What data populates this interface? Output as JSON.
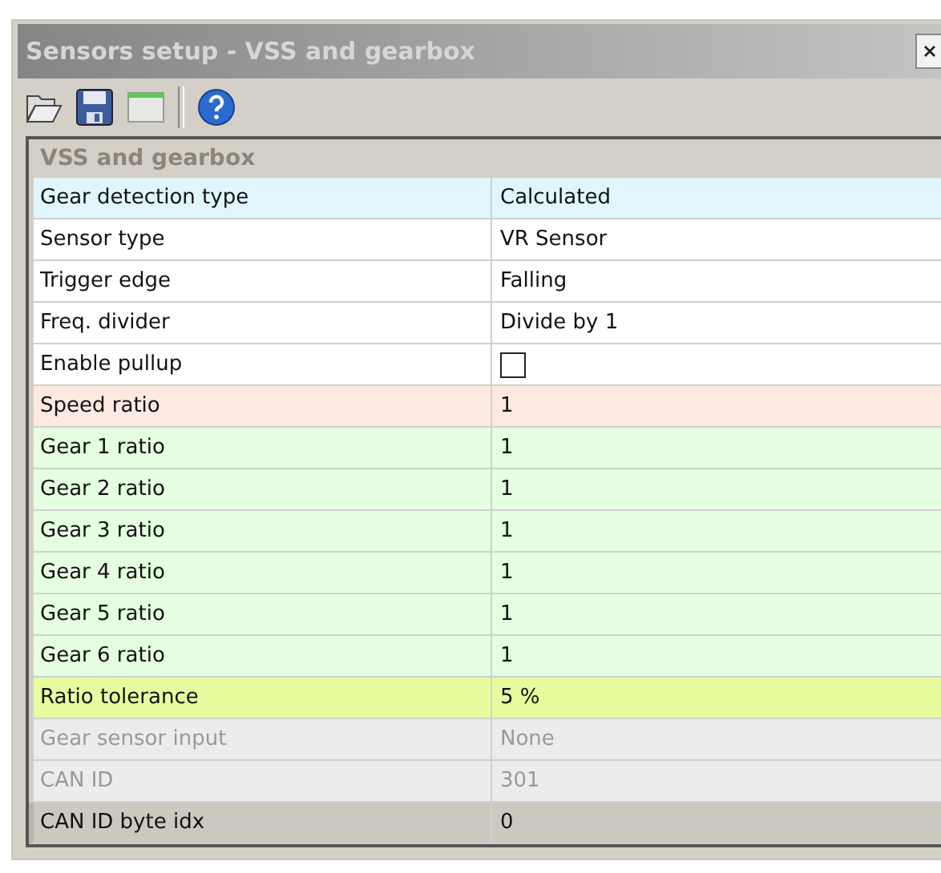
{
  "window": {
    "title": "Sensors setup - VSS and gearbox"
  },
  "grid": {
    "category": "VSS and gearbox",
    "rows": [
      {
        "kind": "text",
        "label": "Gear detection type",
        "value": "Calculated",
        "color": "#e1f5fd",
        "disabled": false,
        "selected": false
      },
      {
        "kind": "text",
        "label": "Sensor type",
        "value": "VR Sensor",
        "color": "#ffffff",
        "disabled": false,
        "selected": false
      },
      {
        "kind": "text",
        "label": "Trigger edge",
        "value": "Falling",
        "color": "#ffffff",
        "disabled": false,
        "selected": false
      },
      {
        "kind": "text",
        "label": "Freq. divider",
        "value": "Divide by 1",
        "color": "#ffffff",
        "disabled": false,
        "selected": false
      },
      {
        "kind": "checkbox",
        "label": "Enable pullup",
        "checked": false,
        "color": "#ffffff",
        "disabled": false,
        "selected": false
      },
      {
        "kind": "text",
        "label": "Speed ratio",
        "value": "1",
        "color": "#fde9e1",
        "disabled": false,
        "selected": false
      },
      {
        "kind": "text",
        "label": "Gear 1 ratio",
        "value": "1",
        "color": "#e5fde1",
        "disabled": false,
        "selected": false
      },
      {
        "kind": "text",
        "label": "Gear 2 ratio",
        "value": "1",
        "color": "#e5fde1",
        "disabled": false,
        "selected": false
      },
      {
        "kind": "text",
        "label": "Gear 3 ratio",
        "value": "1",
        "color": "#e5fde1",
        "disabled": false,
        "selected": false
      },
      {
        "kind": "text",
        "label": "Gear 4 ratio",
        "value": "1",
        "color": "#e5fde1",
        "disabled": false,
        "selected": false
      },
      {
        "kind": "text",
        "label": "Gear 5 ratio",
        "value": "1",
        "color": "#e5fde1",
        "disabled": false,
        "selected": false
      },
      {
        "kind": "text",
        "label": "Gear 6 ratio",
        "value": "1",
        "color": "#e5fde1",
        "disabled": false,
        "selected": false
      },
      {
        "kind": "text",
        "label": "Ratio tolerance",
        "value": "5 %",
        "color": "#e7fd9d",
        "disabled": false,
        "selected": false
      },
      {
        "kind": "text",
        "label": "Gear sensor input",
        "value": "None",
        "color": "#ececec",
        "disabled": true,
        "selected": false
      },
      {
        "kind": "text",
        "label": "CAN ID",
        "value": "301",
        "color": "#ececec",
        "disabled": true,
        "selected": false
      },
      {
        "kind": "text",
        "label": "CAN ID byte idx",
        "value": "0",
        "color": "#ccc8c0",
        "disabled": false,
        "selected": true
      }
    ]
  }
}
